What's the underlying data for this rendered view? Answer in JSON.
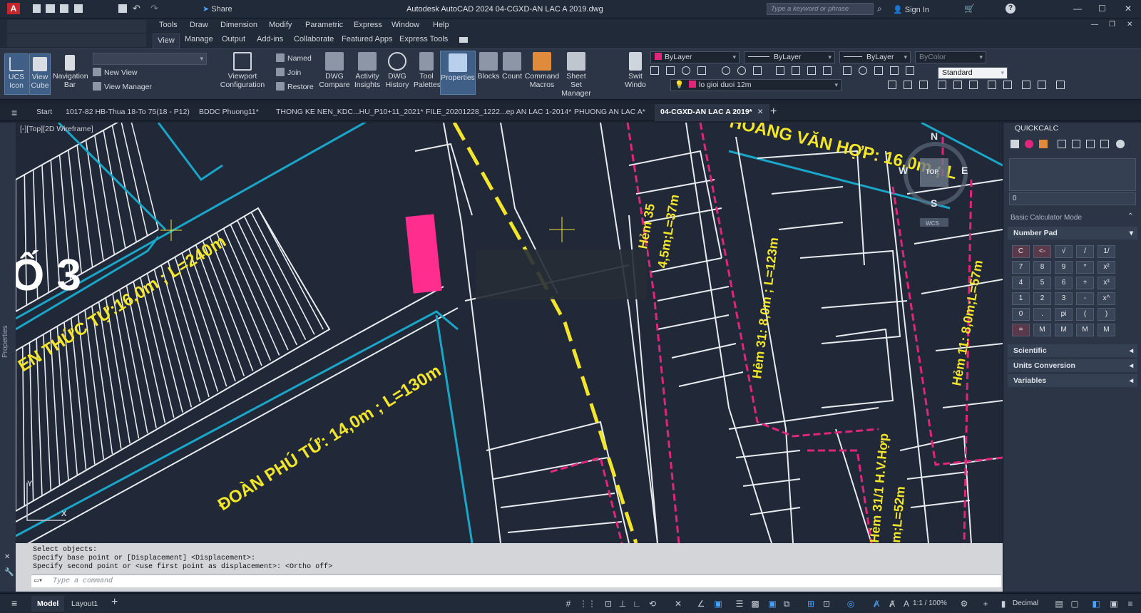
{
  "app": {
    "title": "Autodesk AutoCAD 2024   04-CGXD-AN LAC A 2019.dwg",
    "logo": "A",
    "share_label": "Share",
    "search_placeholder": "Type a keyword or phrase",
    "sign_in": "Sign In"
  },
  "menus": [
    "Tools",
    "Draw",
    "Dimension",
    "Modify",
    "Parametric",
    "Express",
    "Window",
    "Help"
  ],
  "ribbon_tabs": [
    "View",
    "Manage",
    "Output",
    "Add-ins",
    "Collaborate",
    "Featured Apps",
    "Express Tools"
  ],
  "ribbon": {
    "ucs_icon": "UCS\nIcon",
    "view_cube": "View\nCube",
    "navigation_bar": "Navigation\nBar",
    "new_view": "New View",
    "view_manager": "View Manager",
    "viewport_configuration": "Viewport\nConfiguration",
    "named": "Named",
    "join": "Join",
    "restore": "Restore",
    "dwg_compare": "DWG\nCompare",
    "activity_insights": "Activity\nInsights",
    "dwg_history": "DWG\nHistory",
    "tool_palettes": "Tool\nPalettes",
    "properties": "Properties",
    "blocks": "Blocks",
    "count": "Count",
    "command_macros": "Command\nMacros",
    "sheet_set_manager": "Sheet Set\nManager",
    "switch_windows": "Swit\nWindo",
    "layer_color": "ByLayer",
    "linetype": "ByLayer",
    "lineweight": "ByLayer",
    "plotstyle": "ByColor",
    "textstyle": "Standard",
    "layer_name": "lo gioi duoi 12m"
  },
  "file_tabs": [
    "Start",
    "1017-82 HB-Thua 18-To 75(18 - P12)",
    "BDDC Phuong11*",
    "THONG KE NEN_KDC...HU_P10+11_2021*",
    "FILE_20201228_1222...ep AN LAC 1-2014*",
    "PHUONG AN LAC A*",
    "04-CGXD-AN LAC A 2019*"
  ],
  "viewport": {
    "label": "[-][Top][2D Wireframe]",
    "side_label": "Properties",
    "compass": {
      "n": "N",
      "s": "S",
      "e": "E",
      "w": "W",
      "top": "TOP",
      "wcs": "WCS"
    },
    "street_labels": [
      "EN THỨC TỰ:16,0m ; L=240m",
      "ĐOÀN PHÚ TỨ: 14,0m ; L=130m",
      "HOÀNG VĂN HỢP: 16,0m ; L",
      "Hẻm 35",
      "4,5m;L=37m",
      "Hẻm 31: 8,0m ; L=123m",
      "Hẻm 11: 8,0m;L=57m",
      "Hẻm 31/1 H.V.Hợp",
      "m;L=52m"
    ],
    "block_label": "Ố 3",
    "ucs_x": "X",
    "ucs_y": "Y"
  },
  "command": {
    "history": [
      "Select objects:",
      "Specify base point or [Displacement] <Displacement>:",
      "Specify second point or <use first point as displacement>:  <Ortho off>"
    ],
    "placeholder": "Type a command"
  },
  "layouts": [
    "Model",
    "Layout1"
  ],
  "status": {
    "scale": "1:1 / 100%",
    "units": "Decimal"
  },
  "quickcalc": {
    "title": "QUICKCALC",
    "display_value": "0",
    "mode": "Basic Calculator Mode",
    "number_pad": "Number Pad",
    "keys": [
      [
        "C",
        "<-",
        "√",
        "/",
        "1/"
      ],
      [
        "7",
        "8",
        "9",
        "*",
        "x²"
      ],
      [
        "4",
        "5",
        "6",
        "+",
        "x³"
      ],
      [
        "1",
        "2",
        "3",
        "-",
        "x^"
      ],
      [
        "0",
        ".",
        "pi",
        "(",
        ")"
      ],
      [
        "=",
        "M",
        "M",
        "M",
        "M"
      ]
    ],
    "sections": [
      "Scientific",
      "Units Conversion",
      "Variables"
    ]
  },
  "colors": {
    "accent": "#1f6dbf",
    "lines": "#e8ecef",
    "cyan": "#1aa6c9",
    "magenta": "#e0267a",
    "yellow": "#f2e52a"
  }
}
